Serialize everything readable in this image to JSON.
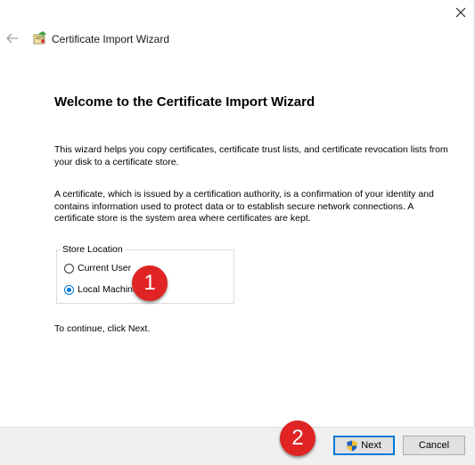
{
  "window": {
    "close_icon": "close-icon",
    "back_icon": "back-arrow-icon"
  },
  "header": {
    "icon": "certificate-icon",
    "title": "Certificate Import Wizard"
  },
  "main": {
    "heading": "Welcome to the Certificate Import Wizard",
    "paragraph1": "This wizard helps you copy certificates, certificate trust lists, and certificate revocation lists from your disk to a certificate store.",
    "paragraph2": "A certificate, which is issued by a certification authority, is a confirmation of your identity and contains information used to protect data or to establish secure network connections. A certificate store is the system area where certificates are kept.",
    "store_location": {
      "legend": "Store Location",
      "options": [
        {
          "label": "Current User",
          "checked": false
        },
        {
          "label": "Local Machine",
          "checked": true
        }
      ]
    },
    "continue_text": "To continue, click Next."
  },
  "annotations": {
    "badge1": "1",
    "badge2": "2",
    "badge_color": "#e02424"
  },
  "footer": {
    "next_label": "Next",
    "cancel_label": "Cancel",
    "shield_icon": "uac-shield-icon",
    "accent": "#0078d7"
  }
}
